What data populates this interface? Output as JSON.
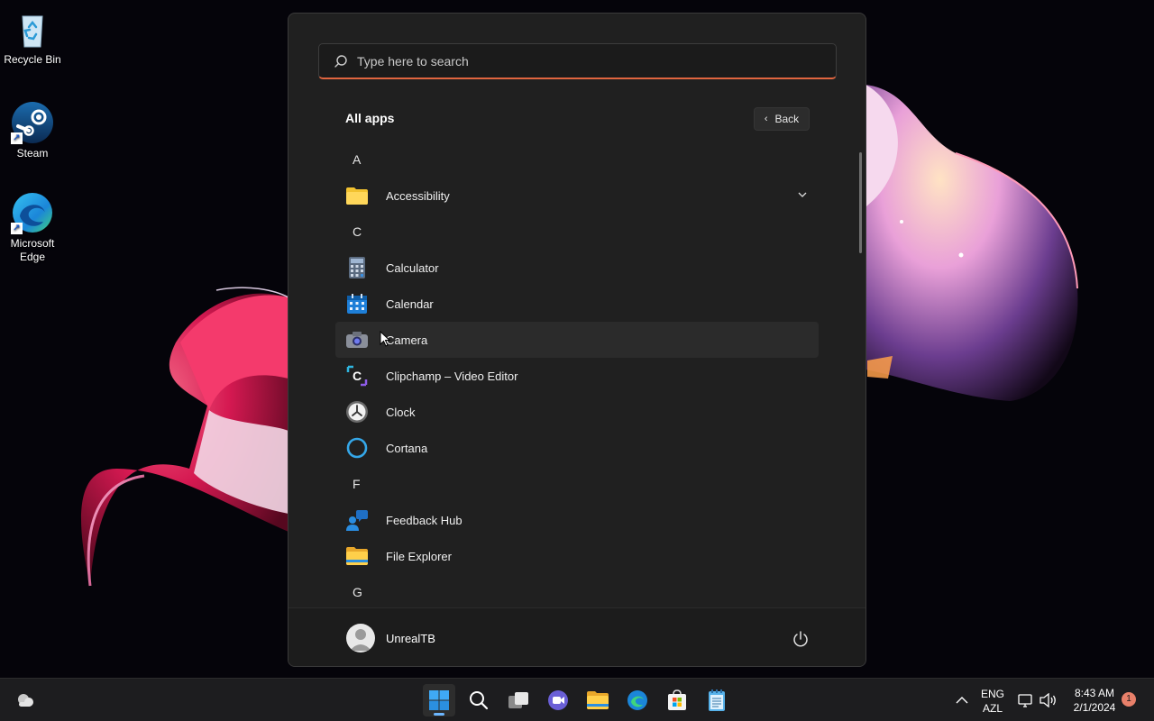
{
  "desktop": {
    "icons": [
      {
        "label": "Recycle Bin"
      },
      {
        "label": "Steam"
      },
      {
        "label": "Microsoft Edge"
      }
    ]
  },
  "start_menu": {
    "search_placeholder": "Type here to search",
    "header": "All apps",
    "back_label": "Back",
    "sections": [
      {
        "letter": "A",
        "apps": [
          {
            "label": "Accessibility",
            "icon": "folder-icon",
            "expandable": true
          }
        ]
      },
      {
        "letter": "C",
        "apps": [
          {
            "label": "Calculator",
            "icon": "calculator-icon"
          },
          {
            "label": "Calendar",
            "icon": "calendar-icon"
          },
          {
            "label": "Camera",
            "icon": "camera-icon",
            "hovered": true
          },
          {
            "label": "Clipchamp – Video Editor",
            "icon": "clipchamp-icon"
          },
          {
            "label": "Clock",
            "icon": "clock-icon"
          },
          {
            "label": "Cortana",
            "icon": "cortana-icon"
          }
        ]
      },
      {
        "letter": "F",
        "apps": [
          {
            "label": "Feedback Hub",
            "icon": "feedback-hub-icon"
          },
          {
            "label": "File Explorer",
            "icon": "file-explorer-icon"
          }
        ]
      },
      {
        "letter": "G",
        "apps": []
      }
    ],
    "user_name": "UnrealTB"
  },
  "taskbar": {
    "apps": [
      "start-icon",
      "search-icon",
      "task-view-icon",
      "teams-chat-icon",
      "file-explorer-icon",
      "edge-icon",
      "store-icon",
      "notepad-icon"
    ],
    "lang_line1": "ENG",
    "lang_line2": "AZL",
    "time": "8:43 AM",
    "date": "2/1/2024",
    "notification_count": "1"
  },
  "colors": {
    "accent": "#e0653f",
    "menu_bg": "#202020",
    "taskbar_bg": "#1d1d1f"
  }
}
